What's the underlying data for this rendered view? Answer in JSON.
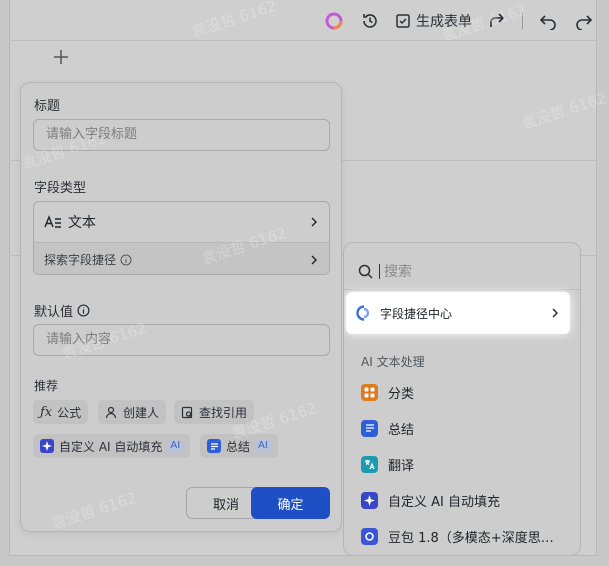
{
  "toolbar": {
    "generate_form_label": "生成表单"
  },
  "panel": {
    "title_label": "标题",
    "title_placeholder": "请输入字段标题",
    "field_type_label": "字段类型",
    "field_type_value": "文本",
    "explore_shortcut": "探索字段捷径",
    "default_value_label": "默认值",
    "default_value_placeholder": "请输入内容",
    "recommend_label": "推荐",
    "chips": {
      "formula": "公式",
      "creator": "创建人",
      "lookup": "查找引用",
      "custom_ai": "自定义 AI 自动填充",
      "summary": "总结",
      "ai_badge": "AI"
    },
    "cancel_label": "取消",
    "confirm_label": "确定"
  },
  "dropdown": {
    "search_placeholder": "搜索",
    "shortcut_center": "字段捷径中心",
    "section_title": "AI 文本处理",
    "items": [
      {
        "label": "分类",
        "icon": "category-icon",
        "color": "#e07a1f"
      },
      {
        "label": "总结",
        "icon": "summary-icon",
        "color": "#2f5fd6"
      },
      {
        "label": "翻译",
        "icon": "translate-icon",
        "color": "#1a9bb0"
      },
      {
        "label": "自定义 AI 自动填充",
        "icon": "ai-sparkle-icon",
        "color": "#3a46c8"
      },
      {
        "label": "豆包 1.8（多模态+深度思…",
        "icon": "doubao-icon",
        "color": "#3a55d8"
      }
    ]
  },
  "watermark": "袁没哲 6162",
  "colors": {
    "primary": "#1f4fc4",
    "ai_accent": "#3b5fc6"
  }
}
